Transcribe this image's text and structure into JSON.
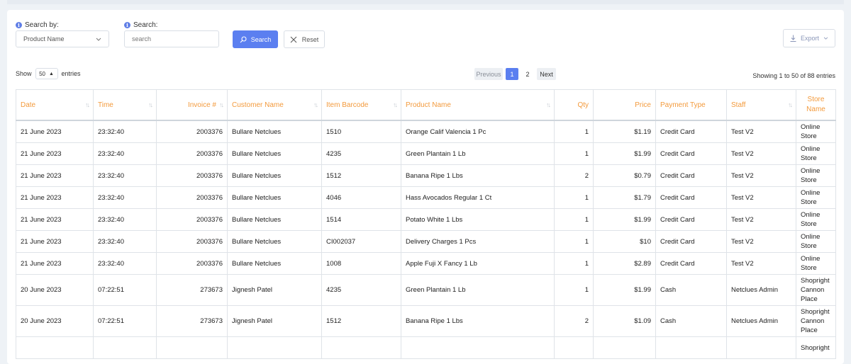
{
  "filters": {
    "search_by_label": "Search by:",
    "search_by_value": "Product Name",
    "search_label": "Search:",
    "search_placeholder": "search",
    "search_button": "Search",
    "reset_button": "Reset",
    "export_button": "Export"
  },
  "length": {
    "show": "Show",
    "value": "50",
    "entries": "entries"
  },
  "pagination": {
    "previous": "Previous",
    "pages": [
      "1",
      "2"
    ],
    "active": "1",
    "next": "Next"
  },
  "info": "Showing 1 to 50 of 88 entries",
  "table": {
    "columns": [
      "Date",
      "Time",
      "Invoice #",
      "Customer Name",
      "Item Barcode",
      "Product Name",
      "Qty",
      "Price",
      "Payment Type",
      "Staff",
      "Store Name"
    ],
    "rows": [
      [
        "21 June 2023",
        "23:32:40",
        "2003376",
        "Bullare Netclues",
        "1510",
        "Orange Calif Valencia 1 Pc",
        "1",
        "$1.19",
        "Credit Card",
        "Test V2",
        "Online Store"
      ],
      [
        "21 June 2023",
        "23:32:40",
        "2003376",
        "Bullare Netclues",
        "4235",
        "Green Plantain 1 Lb",
        "1",
        "$1.99",
        "Credit Card",
        "Test V2",
        "Online Store"
      ],
      [
        "21 June 2023",
        "23:32:40",
        "2003376",
        "Bullare Netclues",
        "1512",
        "Banana Ripe 1 Lbs",
        "2",
        "$0.79",
        "Credit Card",
        "Test V2",
        "Online Store"
      ],
      [
        "21 June 2023",
        "23:32:40",
        "2003376",
        "Bullare Netclues",
        "4046",
        "Hass Avocados Regular 1 Ct",
        "1",
        "$1.79",
        "Credit Card",
        "Test V2",
        "Online Store"
      ],
      [
        "21 June 2023",
        "23:32:40",
        "2003376",
        "Bullare Netclues",
        "1514",
        "Potato White 1 Lbs",
        "1",
        "$1.99",
        "Credit Card",
        "Test V2",
        "Online Store"
      ],
      [
        "21 June 2023",
        "23:32:40",
        "2003376",
        "Bullare Netclues",
        "CI002037",
        "Delivery Charges 1 Pcs",
        "1",
        "$10",
        "Credit Card",
        "Test V2",
        "Online Store"
      ],
      [
        "21 June 2023",
        "23:32:40",
        "2003376",
        "Bullare Netclues",
        "1008",
        "Apple Fuji X Fancy 1 Lb",
        "1",
        "$2.89",
        "Credit Card",
        "Test V2",
        "Online Store"
      ],
      [
        "20 June 2023",
        "07:22:51",
        "273673",
        "Jignesh Patel",
        "4235",
        "Green Plantain 1 Lb",
        "1",
        "$1.99",
        "Cash",
        "Netclues Admin",
        "Shopright Cannon Place"
      ],
      [
        "20 June 2023",
        "07:22:51",
        "273673",
        "Jignesh Patel",
        "1512",
        "Banana Ripe 1 Lbs",
        "2",
        "$1.09",
        "Cash",
        "Netclues Admin",
        "Shopright Cannon Place"
      ],
      [
        "",
        "",
        "",
        "",
        "",
        "",
        "",
        "",
        "",
        "",
        "Shopright"
      ]
    ]
  }
}
